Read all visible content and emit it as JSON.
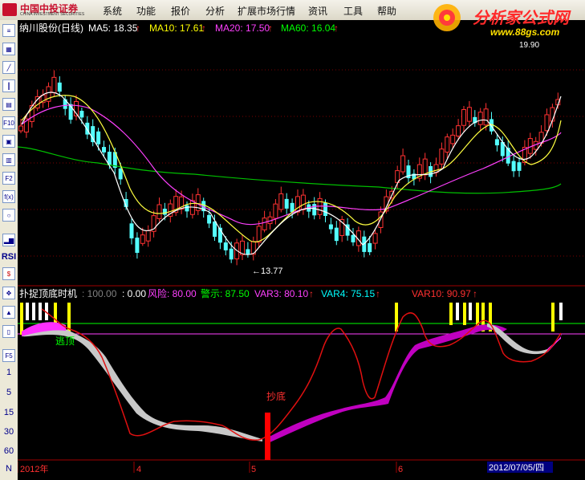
{
  "menubar": {
    "logo_cn": "中国中投证券",
    "logo_en": "CHINA INVESTMENT SECURITIES",
    "items": [
      "系统",
      "功能",
      "报价",
      "分析",
      "扩展市场行情",
      "资讯",
      "工具",
      "帮助"
    ]
  },
  "watermark": {
    "title": "分析家公式网",
    "url": "www.88gs.com"
  },
  "toolbar": {
    "icons": [
      "list-icon",
      "grid-icon",
      "line-chart-icon",
      "candle-icon",
      "tiles-icon",
      "f10-icon",
      "window-icon",
      "bag-icon",
      "f2-icon",
      "fx-icon",
      "zoom-icon",
      "bar-chart-icon"
    ],
    "labels": {
      "rsi": "RSI",
      "f5": "F5",
      "n": "N"
    },
    "period_labels": [
      "1",
      "5",
      "15",
      "30",
      "60"
    ]
  },
  "main_chart": {
    "title": "纳川股份(日线)",
    "ma": [
      {
        "label": "MA5: 18.35",
        "arrow": "↑",
        "color": "#ffffff"
      },
      {
        "label": "MA10: 17.61",
        "arrow": "↑",
        "color": "#ffff00"
      },
      {
        "label": "MA20: 17.50",
        "arrow": "↑",
        "color": "#ff40ff"
      },
      {
        "label": "MA60: 16.04",
        "arrow": "↑",
        "color": "#00ff00"
      }
    ],
    "low_label": "←13.77",
    "high_label": "19.90"
  },
  "indicator": {
    "title": "扑捉顶底时机",
    "params": [
      {
        "text": ": 100.00",
        "color": "#808080"
      },
      {
        "text": ": 0.00",
        "color": "#ffffff"
      },
      {
        "text": "风险: 80.00",
        "color": "#ff40ff"
      },
      {
        "text": "警示: 87.50",
        "color": "#00ff00"
      },
      {
        "text": "VAR3: 80.10",
        "color": "#ff40ff",
        "arrow": "↑"
      },
      {
        "text": "VAR4: 75.15",
        "color": "#00ffff",
        "arrow": "↑"
      },
      {
        "text": "VAR10: 90.97",
        "color": "#ff3030",
        "arrow": "↑"
      }
    ],
    "escape_top": "逃顶",
    "buy_bottom": "抄底"
  },
  "time_axis": {
    "labels": [
      "2012年",
      "4",
      "5",
      "6"
    ],
    "cursor_date": "2012/07/05/四"
  },
  "colors": {
    "up": "#ff3232",
    "down": "#54ffff",
    "ma5": "#ffffff",
    "ma10": "#ffff00",
    "ma20": "#ff40ff",
    "ma60": "#00ff00"
  }
}
